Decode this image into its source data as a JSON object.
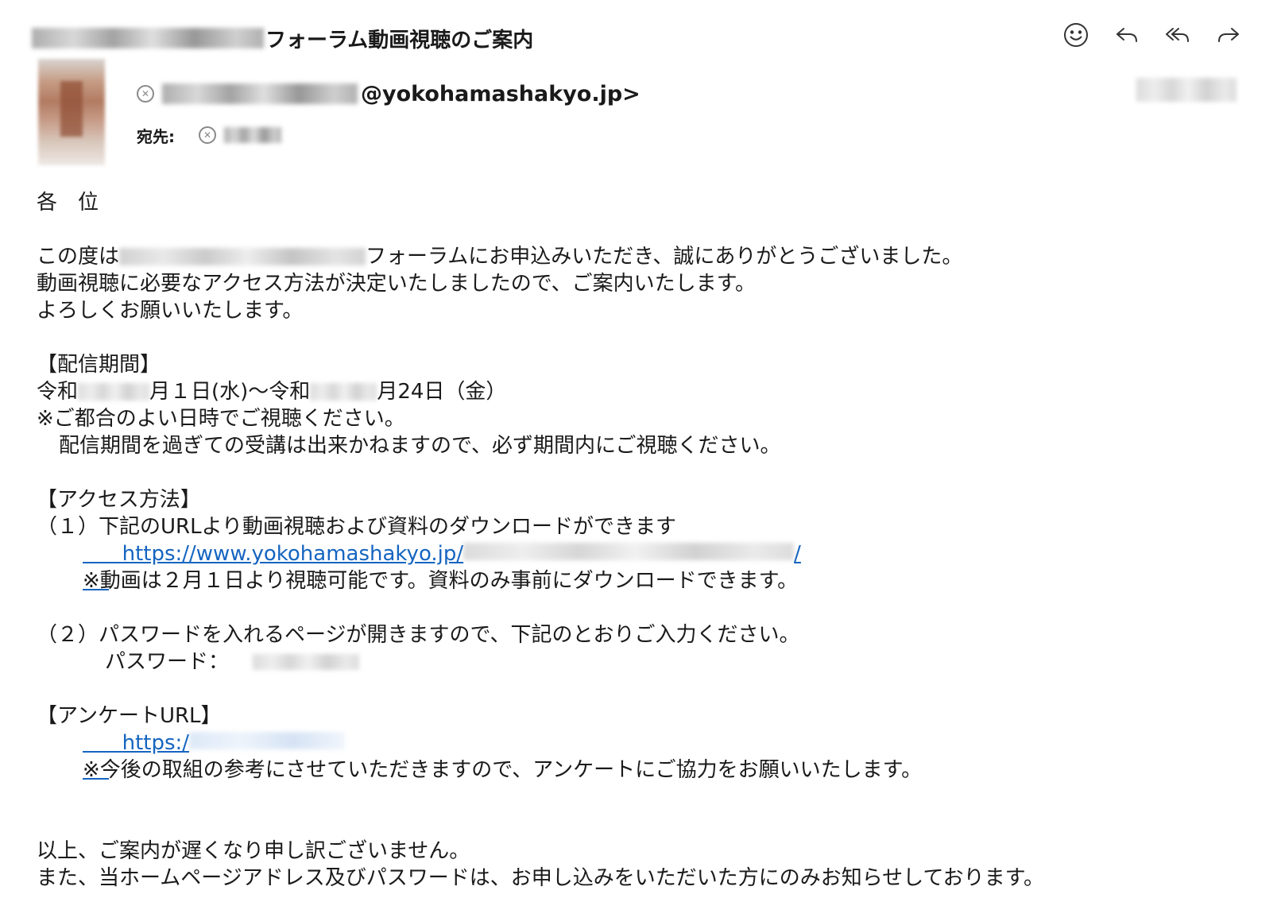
{
  "email": {
    "subject": "フォーラム動画視聴のご案内",
    "from_suffix": "@yokohamashakyo.jp>",
    "to_label": "宛先:",
    "actions": {
      "emoji_icon": "smiley-icon",
      "reply_icon": "reply-icon",
      "reply_all_icon": "reply-all-icon",
      "forward_icon": "forward-icon"
    }
  },
  "body": {
    "salutation": "各　位",
    "intro_1a": "この度は",
    "intro_1b": "フォーラムにお申込みいただき、誠にありがとうございました。",
    "intro_2": "動画視聴に必要なアクセス方法が決定いたしましたので、ご案内いたします。",
    "intro_3": "よろしくお願いいたします。",
    "period_heading": "【配信期間】",
    "period_a": "令和",
    "period_b": "月１日(水)〜令和",
    "period_c": "月24日（金）",
    "period_note_1": "※ご都合のよい日時でご視聴ください。",
    "period_note_2": "配信期間を過ぎての受講は出来かねますので、必ず期間内にご視聴ください。",
    "access_heading": "【アクセス方法】",
    "step1": "（１）下記のURLより動画視聴および資料のダウンロードができます",
    "step1_link_prefix": "https://www.yokohamashakyo.jp/",
    "step1_link_suffix": "/",
    "step1_note": "※動画は２月１日より視聴可能です。資料のみ事前にダウンロードできます。",
    "step2": "（２）パスワードを入れるページが開きますので、下記のとおりご入力ください。",
    "password_label": "パスワード：",
    "survey_heading": "【アンケートURL】",
    "survey_link_prefix": "https:/",
    "survey_note": "※今後の取組の参考にさせていただきますので、アンケートにご協力をお願いいたします。",
    "closing_1": "以上、ご案内が遅くなり申し訳ございません。",
    "closing_2": "また、当ホームページアドレス及びパスワードは、お申し込みをいただいた方にのみお知らせしております。"
  }
}
